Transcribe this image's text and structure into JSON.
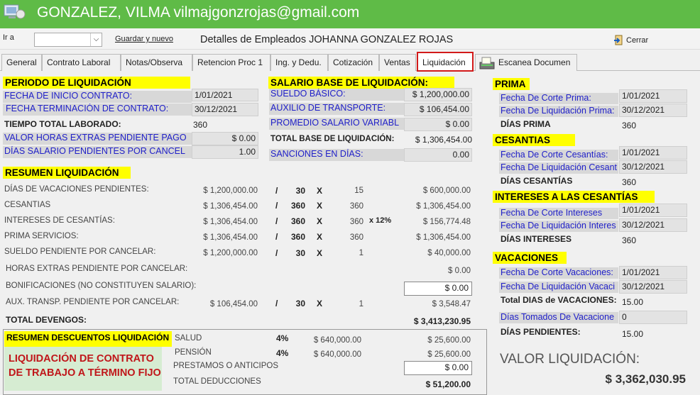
{
  "window": {
    "title": "GONZALEZ, VILMA vilmajgonzrojas@gmail.com"
  },
  "toolbar": {
    "goto_label": "Ir a",
    "save_new_label": "Guardar y nuevo",
    "details_label": "Detalles de Empleados JOHANNA GONZALEZ ROJAS",
    "close_label": "Cerrar"
  },
  "tabs": [
    "General",
    "Contrato Laboral",
    "Notas/Observa",
    "Retencion Proc 1",
    "Ing. y Dedu.",
    "Cotización",
    "Ventas",
    "Liquidación",
    "Escanea Documen"
  ],
  "periodo": {
    "heading": "PERIODO DE LIQUIDACIÓN",
    "rows": [
      {
        "label": "FECHA DE INICIO CONTRATO:",
        "value": "1/01/2021"
      },
      {
        "label": "FECHA TERMINACIÓN DE CONTRATO:",
        "value": "30/12/2021"
      }
    ],
    "tiempo_label": "TIEMPO TOTAL LABORADO:",
    "tiempo_value": "360",
    "horas_label": "VALOR HORAS EXTRAS PENDIENTE PAGO",
    "horas_value": "$ 0.00",
    "dias_label": "DÍAS SALARIO PENDIENTES POR CANCEL",
    "dias_value": "1.00"
  },
  "salario": {
    "heading": "SALARIO BASE DE LIQUIDACIÓN:",
    "rows": [
      {
        "label": "SUELDO BÁSICO:",
        "value": "$ 1,200,000.00"
      },
      {
        "label": "AUXILIO DE TRANSPORTE:",
        "value": "$ 106,454.00"
      },
      {
        "label": "PROMEDIO SALARIO VARIABL",
        "value": "$ 0.00"
      }
    ],
    "total_label": "TOTAL BASE DE LIQUIDACIÓN:",
    "total_value": "$ 1,306,454.00",
    "sanciones_label": "SANCIONES EN DÍAS:",
    "sanciones_value": "0.00"
  },
  "resumen": {
    "heading": "RESUMEN LIQUIDACIÓN",
    "rows": [
      {
        "label": "DÍAS DE VACACIONES PENDIENTES:",
        "base": "$ 1,200,000.00",
        "slash": "/",
        "div": "30",
        "x": "X",
        "days": "15",
        "extra": "",
        "total": "$ 600,000.00"
      },
      {
        "label": "CESANTIAS",
        "base": "$ 1,306,454.00",
        "slash": "/",
        "div": "360",
        "x": "X",
        "days": "360",
        "extra": "",
        "total": "$ 1,306,454.00"
      },
      {
        "label": "INTERESES DE CESANTÍAS:",
        "base": "$ 1,306,454.00",
        "slash": "/",
        "div": "360",
        "x": "X",
        "days": "360",
        "extra": "x 12%",
        "total": "$ 156,774.48"
      },
      {
        "label": "PRIMA SERVICIOS:",
        "base": "$ 1,306,454.00",
        "slash": "/",
        "div": "360",
        "x": "X",
        "days": "360",
        "extra": "",
        "total": "$ 1,306,454.00"
      },
      {
        "label": "SUELDO PENDIENTE POR CANCELAR:",
        "base": "$ 1,200,000.00",
        "slash": "/",
        "div": "30",
        "x": "X",
        "days": "1",
        "extra": "",
        "total": "$ 40,000.00"
      }
    ],
    "horas_label": "HORAS EXTRAS PENDIENTE POR CANCELAR:",
    "horas_value": "$ 0.00",
    "bonif_label": "BONIFICACIONES (NO CONSTITUYEN SALARIO):",
    "bonif_value": "$ 0.00",
    "aux": {
      "label": "AUX. TRANSP. PENDIENTE POR CANCELAR:",
      "base": "$ 106,454.00",
      "slash": "/",
      "div": "30",
      "x": "X",
      "days": "1",
      "total": "$ 3,548.47"
    },
    "devengos_label": "TOTAL DEVENGOS:",
    "devengos_value": "$ 3,413,230.95"
  },
  "descuentos": {
    "heading": "RESUMEN DESCUENTOS LIQUIDACIÓN",
    "contract_line1": "LIQUIDACIÓN DE CONTRATO",
    "contract_line2": "DE TRABAJO A TÉRMINO FIJO",
    "salud": {
      "label": "SALUD",
      "pct": "4%",
      "base": "$ 640,000.00",
      "value": "$ 25,600.00"
    },
    "pension": {
      "label": "PENSIÓN",
      "pct": "4%",
      "base": "$ 640,000.00",
      "value": "$ 25,600.00"
    },
    "prestamos_label": "PRESTAMOS O ANTICIPOS",
    "prestamos_value": "$ 0.00",
    "total_label": "TOTAL DEDUCCIONES",
    "total_value": "$ 51,200.00"
  },
  "prima": {
    "heading": "PRIMA",
    "corte_label": "Fecha De Corte Prima:",
    "corte_value": "1/01/2021",
    "liq_label": "Fecha De Liquidación Prima:",
    "liq_value": "30/12/2021",
    "dias_label": "DÍAS PRIMA",
    "dias_value": "360"
  },
  "cesantias": {
    "heading": "CESANTIAS",
    "corte_label": "Fecha De Corte Cesantías:",
    "corte_value": "1/01/2021",
    "liq_label": "Fecha De Liquidación Cesant",
    "liq_value": "30/12/2021",
    "dias_label": "DÍAS CESANTÍAS",
    "dias_value": "360"
  },
  "intereses": {
    "heading": "INTERESES A LAS CESANTÍAS",
    "corte_label": "Fecha De Corte Intereses",
    "corte_value": "1/01/2021",
    "liq_label": "Fecha De Liquidación Interes",
    "liq_value": "30/12/2021",
    "dias_label": "DÍAS INTERESES",
    "dias_value": "360"
  },
  "vacaciones": {
    "heading": "VACACIONES",
    "corte_label": "Fecha De Corte Vacaciones:",
    "corte_value": "1/01/2021",
    "liq_label": "Fecha De Liquidación Vacaci",
    "liq_value": "30/12/2021",
    "total_label": "Total DIAS de VACACIONES:",
    "total_value": "15.00",
    "tomados_label": "Días Tomados De Vacacione",
    "tomados_value": "0",
    "pend_label": "DÍAS PENDIENTES:",
    "pend_value": "15.00"
  },
  "valor": {
    "label": "VALOR LIQUIDACIÓN:",
    "value": "$ 3,362,030.95"
  }
}
